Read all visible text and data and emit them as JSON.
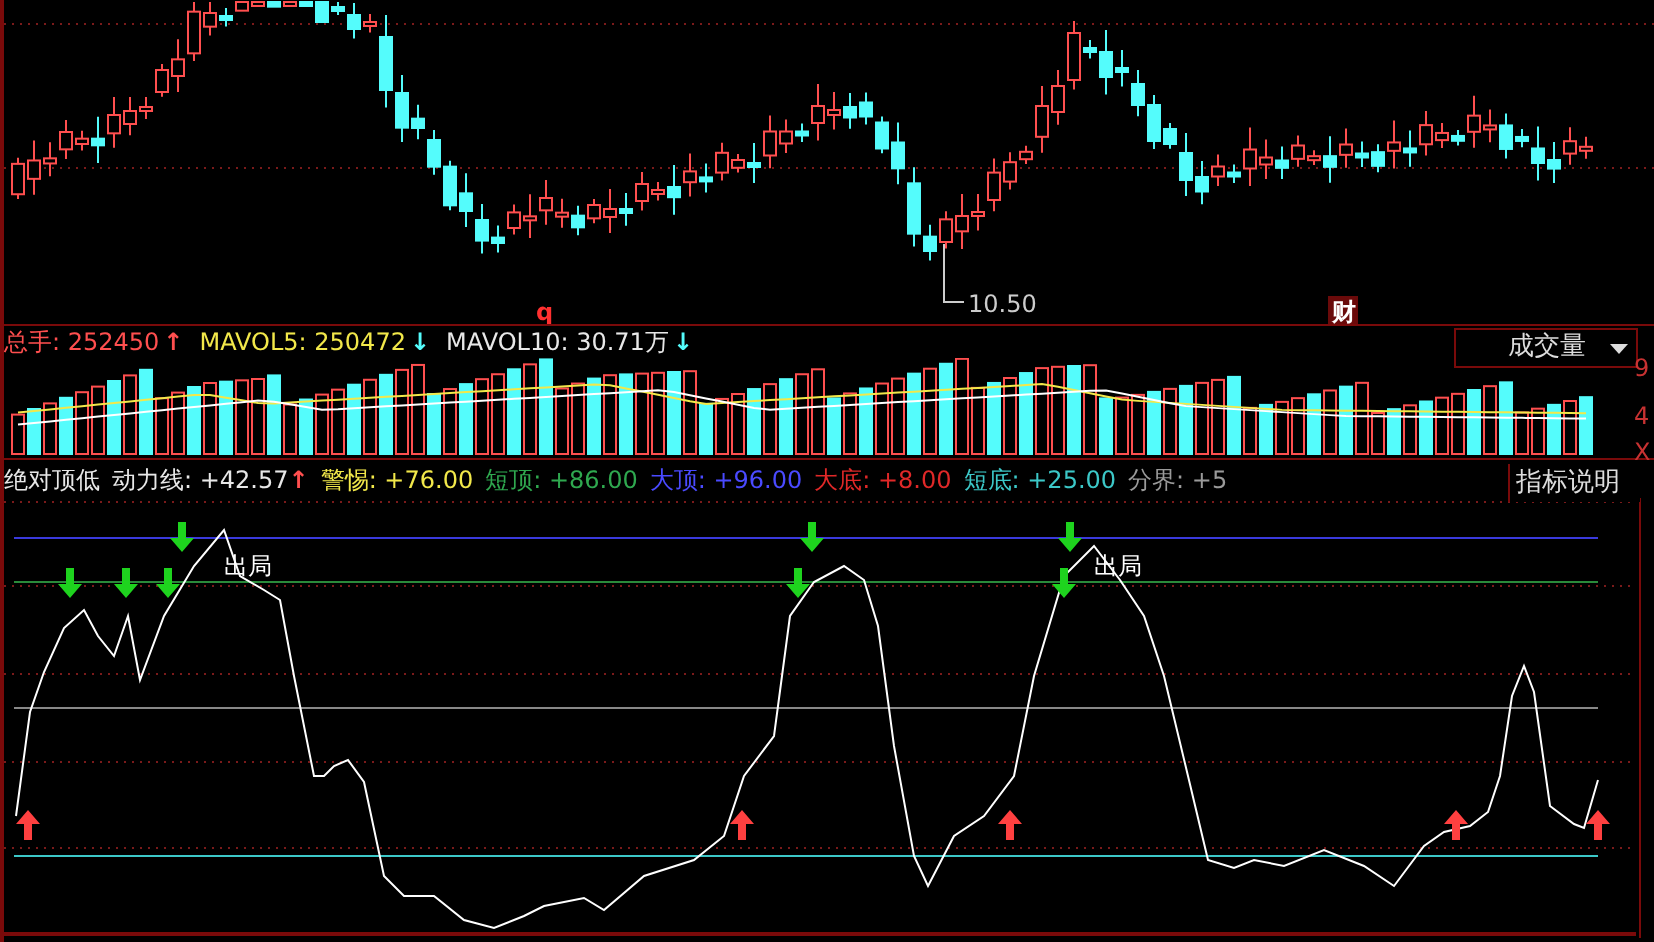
{
  "price_chart": {
    "markers": [
      "q",
      "财"
    ],
    "low_label": "10.50"
  },
  "volume_header": {
    "items": [
      {
        "label": "总手:",
        "value": "252450",
        "color": "#ff4f4f",
        "arrow": "↑",
        "rising": true
      },
      {
        "label": "MAVOL5:",
        "value": "250472",
        "color": "#f2e84a",
        "arrow": "↓",
        "rising": false
      },
      {
        "label": "MAVOL10:",
        "value": "30.71万",
        "color": "#e8e8e8",
        "arrow": "↓",
        "rising": false
      }
    ],
    "dropdown": "成交量",
    "axis_labels": [
      "9",
      "4",
      "X"
    ]
  },
  "indicator_header": {
    "title": "绝对顶低",
    "items": [
      {
        "label": "动力线:",
        "value": "+42.57",
        "color": "#e8e8e8",
        "arrow": "↑",
        "rising": true
      },
      {
        "label": "警惕:",
        "value": "+76.00",
        "color": "#f2e84a"
      },
      {
        "label": "短顶:",
        "value": "+86.00",
        "color": "#2fa84f"
      },
      {
        "label": "大顶:",
        "value": "+96.00",
        "color": "#4a4aff"
      },
      {
        "label": "大底:",
        "value": "+8.00",
        "color": "#e02828"
      },
      {
        "label": "短底:",
        "value": "+25.00",
        "color": "#3cc8c8"
      },
      {
        "label": "分界:",
        "value": "+5",
        "color": "#9a9a9a"
      }
    ],
    "button": "指标说明"
  },
  "indicator_chart": {
    "signals": [
      "出局",
      "出局"
    ]
  }
}
